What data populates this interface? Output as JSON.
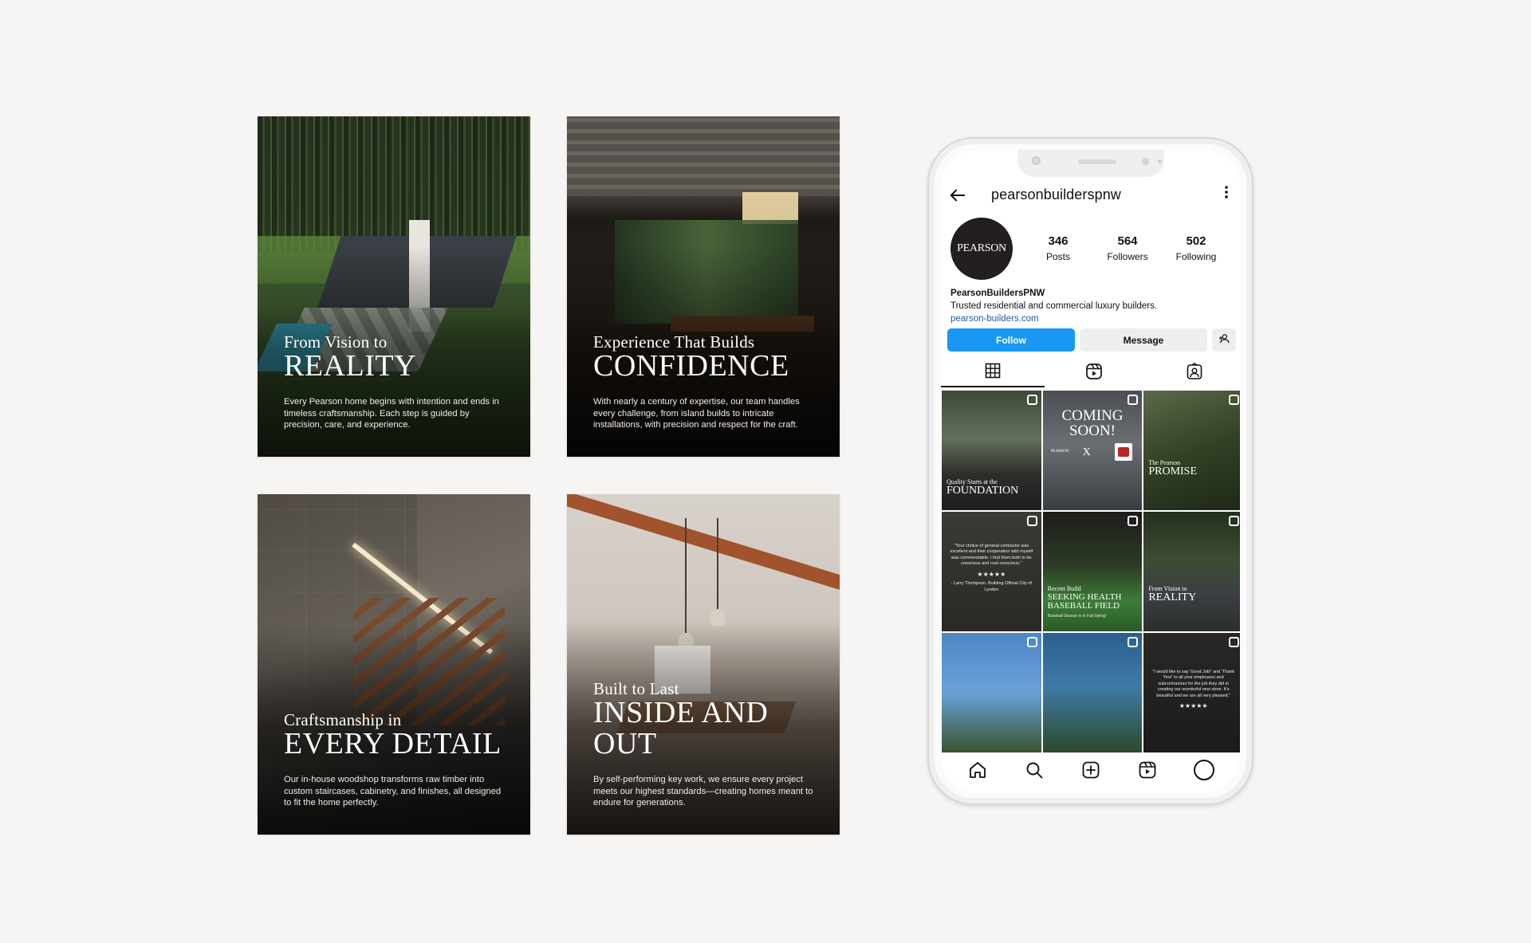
{
  "posts": [
    {
      "kicker": "From Vision to",
      "headline": "REALITY",
      "body": "Every Pearson home begins with intention and ends in timeless craftsmanship. Each step is guided by precision, care, and experience."
    },
    {
      "kicker": "Experience That Builds",
      "headline": "CONFIDENCE",
      "body": "With nearly a century of expertise, our team handles every challenge, from island builds to intricate installations, with precision and respect for the craft."
    },
    {
      "kicker": "Craftsmanship in",
      "headline": "EVERY DETAIL",
      "body": "Our in-house woodshop transforms raw timber into custom staircases, cabinetry, and finishes, all designed to fit the home perfectly."
    },
    {
      "kicker": "Built to Last",
      "headline": "INSIDE AND OUT",
      "body": "By self-performing key work, we ensure every project meets our highest standards—creating homes meant to endure for generations."
    }
  ],
  "profile": {
    "username": "pearsonbuilderspnw",
    "avatar_text": "PEARSON",
    "stats": [
      {
        "value": "346",
        "label": "Posts"
      },
      {
        "value": "564",
        "label": "Followers"
      },
      {
        "value": "502",
        "label": "Following"
      }
    ],
    "display_name": "PearsonBuildersPNW",
    "bio": "Trusted residential and commercial luxury builders.",
    "website": "pearson-builders.com"
  },
  "actions": {
    "follow": "Follow",
    "message": "Message"
  },
  "grid_posts": [
    {
      "kicker": "Quality Starts at the",
      "headline": "FOUNDATION"
    },
    {
      "headline": "COMING SOON!",
      "brand": "PEARSON",
      "separator": "X"
    },
    {
      "kicker": "The Pearson",
      "headline": "PROMISE"
    },
    {
      "quote": "\"Your choice of general contractor was excellent and their cooperation with myself was commendable. I find them both to be conscious and cost conscious.\"",
      "stars": "★★★★★",
      "author": "- Larry Thompson, Building Official City of Lynden"
    },
    {
      "kicker": "Recent Build",
      "headline": "SEEKING HEALTH BASEBALL FIELD",
      "body": "Baseball Season is in Full Swing!"
    },
    {
      "kicker": "From Vision to",
      "headline": "REALITY"
    },
    {},
    {},
    {
      "quote": "\"I would like to say 'Good Job!' and 'Thank You!' to all your employees and subcontractors for the job they did in creating our wonderful new store. It's beautiful and we are all very pleased.\"",
      "stars": "★★★★★"
    }
  ],
  "colors": {
    "background": "#f7f5f4",
    "follow_button": "#1897f3",
    "link": "#2a57a8",
    "avatar": "#221f1e"
  }
}
